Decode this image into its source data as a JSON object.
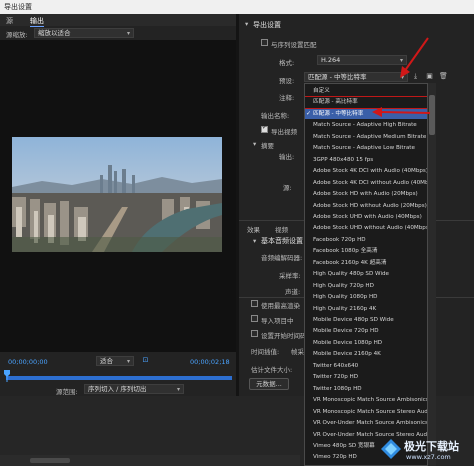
{
  "window": {
    "title": "导出设置"
  },
  "left": {
    "tabs": [
      "源",
      "输出"
    ],
    "source_scaling_label": "源缩放:",
    "source_scaling_value": "缩放以适合",
    "timecode_start": "00;00;00;00",
    "fit_value": "适合",
    "timecode_end": "00;00;02;18",
    "range_label": "源范围:",
    "range_value": "序列切入 / 序列切出"
  },
  "right": {
    "export_settings_title": "导出设置",
    "match_sequence_label": "与序列设置匹配",
    "format_label": "格式:",
    "format_value": "H.264",
    "preset_label": "预设:",
    "preset_value": "匹配源 - 中等比特率",
    "comment_label": "注释:",
    "output_name_label": "输出名称:",
    "export_video_label": "导出视频",
    "summary_label": "摘要",
    "output_label": "输出:",
    "source_label": "源:",
    "tabs": [
      "效果",
      "视频"
    ],
    "audio_basic_title": "基本音频设置",
    "audio_codec_label": "音频编解码器:",
    "sample_rate_label": "采样率:",
    "channels_label": "声道:",
    "use_max_render_label": "使用最高渲染",
    "import_project_label": "导入项目中",
    "set_start_timecode_label": "设置开始时间码",
    "time_interp_label": "时间插值:",
    "time_interp_value": "帧采",
    "est_size_label": "估计文件大小:",
    "metadata_button": "元数据..."
  },
  "preset_dropdown": {
    "options": [
      "自定义",
      "匹配源 - 高比特率",
      "匹配源 - 中等比特率",
      "Match Source - Adaptive High Bitrate",
      "Match Source - Adaptive Medium Bitrate",
      "Match Source - Adaptive Low Bitrate",
      "3GPP 480x480 15 fps",
      "Adobe Stock 4K DCI with Audio (40Mbps)",
      "Adobe Stock 4K DCI without Audio (40Mbps)",
      "Adobe Stock HD with Audio (20Mbps)",
      "Adobe Stock HD without Audio (20Mbps)",
      "Adobe Stock UHD with Audio (40Mbps)",
      "Adobe Stock UHD without Audio (40Mbps)",
      "Facebook 720p HD",
      "Facebook 1080p 全高清",
      "Facebook 2160p 4K 超高清",
      "High Quality 480p SD Wide",
      "High Quality 720p HD",
      "High Quality 1080p HD",
      "High Quality 2160p 4K",
      "Mobile Device 480p SD Wide",
      "Mobile Device 720p HD",
      "Mobile Device 1080p HD",
      "Mobile Device 2160p 4K",
      "Twitter 640x640",
      "Twitter 720p HD",
      "Twitter 1080p HD",
      "VR Monoscopic Match Source Ambisonics",
      "VR Monoscopic Match Source Stereo Audio",
      "VR Over-Under Match Source Ambisonics",
      "VR Over-Under Match Source Stereo Audio",
      "Vimeo 480p SD 宽银幕",
      "Vimeo 720p HD"
    ],
    "selected_index": 2
  },
  "watermark": {
    "text": "极光下载站",
    "url": "www.xz7.com"
  },
  "colors": {
    "accent": "#3a5fa8",
    "timecode": "#4aa3ff",
    "annotation": "#d01818"
  },
  "icons": [
    "save-preset-icon",
    "import-preset-icon",
    "delete-preset-icon",
    "checkmark-icon",
    "red-arrow-icon"
  ]
}
